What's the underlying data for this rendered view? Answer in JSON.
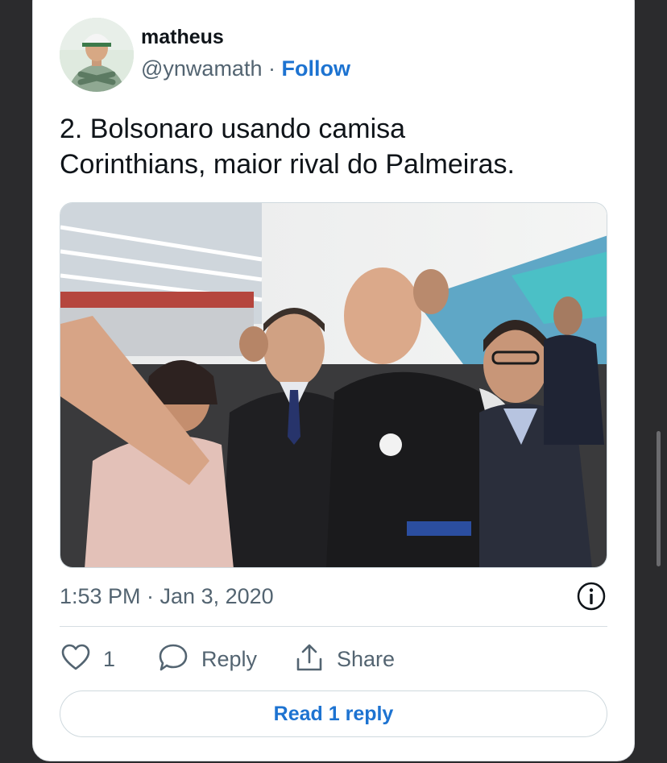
{
  "tweet": {
    "author": {
      "name": "matheus",
      "handle": "@ynwamath",
      "separator": "·",
      "follow_label": "Follow"
    },
    "text_line1": "2. Bolsonaro usando camisa",
    "text_line2": "Corinthians, maior rival do Palmeiras.",
    "timestamp": "1:53 PM · Jan 3, 2020",
    "actions": {
      "like_count": "1",
      "reply_label": "Reply",
      "share_label": "Share"
    },
    "read_replies_label": "Read 1 reply"
  },
  "colors": {
    "link": "#1d73d1",
    "secondary_text": "#536471",
    "primary_text": "#0f1419"
  },
  "icons": [
    "heart-icon",
    "reply-bubble-icon",
    "share-icon",
    "info-icon"
  ]
}
